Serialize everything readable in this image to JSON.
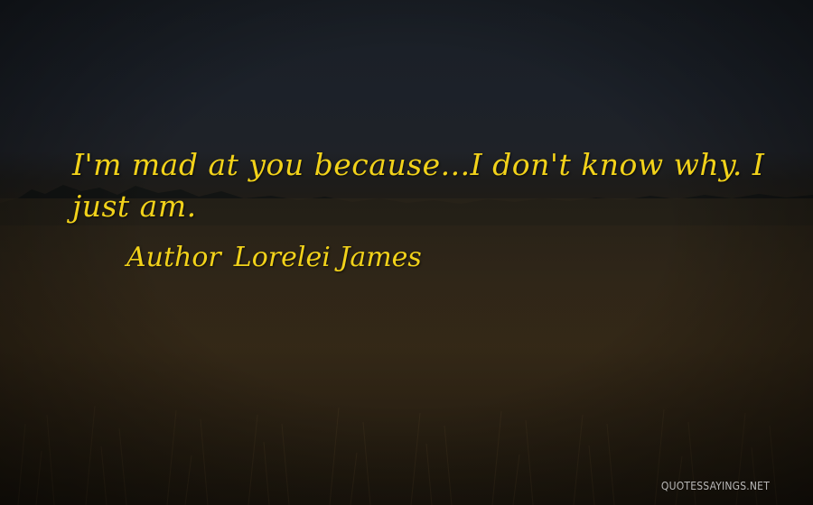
{
  "quote": {
    "text": "I'm mad at you because...I don't know why. I just am."
  },
  "attribution": {
    "label": "Author",
    "name": "Lorelei James"
  },
  "watermark": {
    "text": "QUOTESSAYINGS.NET"
  },
  "colors": {
    "text": "#f2d21a",
    "sky": "#1c2129",
    "field": "#2c2315",
    "watermark": "#c9c9c9"
  }
}
